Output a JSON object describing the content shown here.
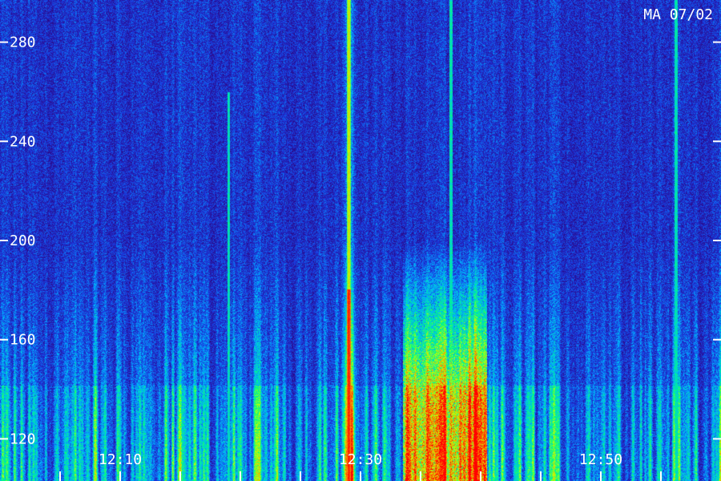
{
  "chart_data": {
    "type": "heatmap",
    "title": "MA 07/02",
    "y_ticks": [
      120,
      160,
      200,
      240,
      280
    ],
    "ylim": [
      103,
      297
    ],
    "x_tick_labels": [
      "12:10",
      "12:30",
      "12:50"
    ],
    "xlim_minutes": [
      0,
      60
    ],
    "x_labeled_minutes": [
      10,
      30,
      50
    ],
    "x_minor_tick_spacing_minutes": 5,
    "colormap": [
      "#1a0040",
      "#2a0a8a",
      "#1a3ae0",
      "#00b4ff",
      "#00ff80",
      "#c8ff00",
      "#ff8000",
      "#ff0000"
    ],
    "features": [
      {
        "kind": "strong-line",
        "time_minutes": 29.0,
        "from": 103,
        "to": 297
      },
      {
        "kind": "broadband",
        "time_range_minutes": [
          33.5,
          40.5
        ],
        "from": 103,
        "to": 200
      },
      {
        "kind": "line",
        "time_minutes": 37.5,
        "from": 103,
        "to": 297
      },
      {
        "kind": "line",
        "time_minutes": 56.2,
        "from": 103,
        "to": 297
      },
      {
        "kind": "line",
        "time_minutes": 19.0,
        "from": 103,
        "to": 260
      }
    ]
  }
}
